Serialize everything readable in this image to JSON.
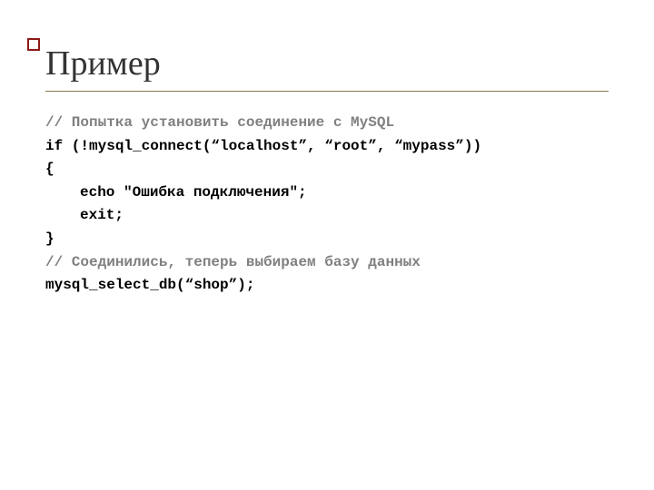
{
  "slide": {
    "title": "Пример",
    "code": {
      "line1_comment": "// Попытка установить соединение с MySQL",
      "line2": "if (!mysql_connect(“localhost”, “root”, “mypass”))",
      "line3": "{",
      "line4": "echo \"Ошибка подключения\";",
      "line5": "exit;",
      "line6": "}",
      "line7_comment": "// Соединились, теперь выбираем базу данных",
      "line8": "mysql_select_db(“shop”);"
    }
  }
}
